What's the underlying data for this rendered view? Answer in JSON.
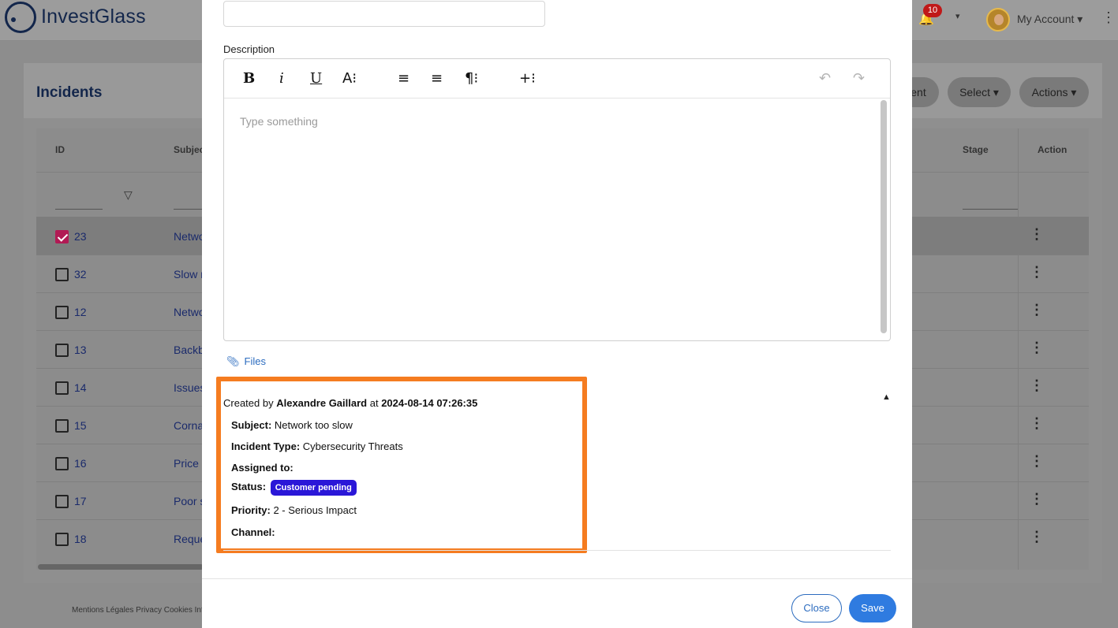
{
  "app": {
    "brand": "InvestGlass"
  },
  "header": {
    "notification_count": "10",
    "account_label": "My Account",
    "icons": [
      "bell-icon",
      "chevron-down-icon",
      "avatar",
      "kebab-icon"
    ]
  },
  "page": {
    "title": "Incidents",
    "buttons": {
      "new_partial": "ent",
      "select": "Select",
      "actions": "Actions"
    },
    "columns": {
      "id": "ID",
      "subject": "Subjec",
      "stage": "Stage",
      "action": "Action"
    },
    "rows": [
      {
        "id": "23",
        "subject": "Netwo",
        "checked": true
      },
      {
        "id": "32",
        "subject": "Slow n",
        "checked": false
      },
      {
        "id": "12",
        "subject": "Netwo",
        "checked": false
      },
      {
        "id": "13",
        "subject": "Backb",
        "checked": false
      },
      {
        "id": "14",
        "subject": "Issues",
        "checked": false
      },
      {
        "id": "15",
        "subject": "Corna",
        "checked": false
      },
      {
        "id": "16",
        "subject": "Price C",
        "checked": false
      },
      {
        "id": "17",
        "subject": "Poor s",
        "checked": false
      },
      {
        "id": "18",
        "subject": "Reque",
        "checked": false
      }
    ],
    "footer_links": "Mentions Légales Privacy Cookies Info"
  },
  "modal": {
    "description_label": "Description",
    "editor": {
      "toolbar": [
        "B",
        "i",
        "U",
        "A⁝",
        "≡",
        "≡",
        "¶⁝",
        "+⁝",
        "↶",
        "↷"
      ],
      "placeholder": "Type something"
    },
    "files_label": "Files",
    "meta": {
      "created_prefix": "Created by",
      "created_by": "Alexandre Gaillard",
      "created_mid": "at",
      "created_at": "2024-08-14 07:26:35"
    },
    "details": {
      "subject_label": "Subject:",
      "subject_value": "Network too slow",
      "type_label": "Incident Type:",
      "type_value": "Cybersecurity Threats",
      "assigned_label": "Assigned to:",
      "assigned_value": "",
      "status_label": "Status:",
      "status_value": "Customer pending",
      "priority_label": "Priority:",
      "priority_value": "2 - Serious Impact",
      "channel_label": "Channel:",
      "channel_value": ""
    },
    "buttons": {
      "close": "Close",
      "save": "Save"
    }
  },
  "colors": {
    "brand": "#13264b",
    "primary": "#2f7be0",
    "status_badge": "#2a17d8",
    "highlight": "#f57c20",
    "notification": "#c01818"
  }
}
